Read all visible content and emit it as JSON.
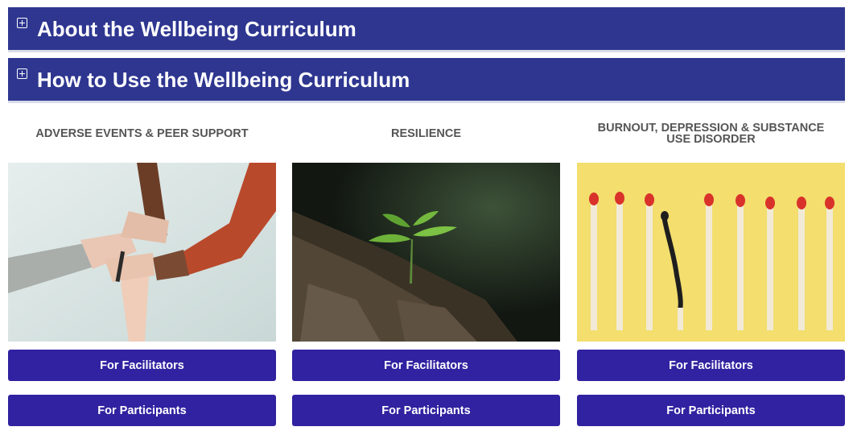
{
  "accordions": [
    {
      "title": "About the Wellbeing Curriculum",
      "icon": "plus-square-icon"
    },
    {
      "title": "How to Use the Wellbeing Curriculum",
      "icon": "plus-square-icon"
    }
  ],
  "topics": [
    {
      "heading": "ADVERSE EVENTS & PEER SUPPORT",
      "image": "joined-hands-photo",
      "facilitators_label": "For Facilitators",
      "participants_label": "For Participants"
    },
    {
      "heading": "RESILIENCE",
      "image": "seedling-on-log-photo",
      "facilitators_label": "For Facilitators",
      "participants_label": "For Participants"
    },
    {
      "heading": "BURNOUT, DEPRESSION & SUBSTANCE USE DISORDER",
      "image": "burnt-match-photo",
      "facilitators_label": "For Facilitators",
      "participants_label": "For Participants"
    }
  ],
  "colors": {
    "accordion_bg": "#2e3690",
    "button_bg": "#3022a0",
    "heading_text": "#555555"
  }
}
